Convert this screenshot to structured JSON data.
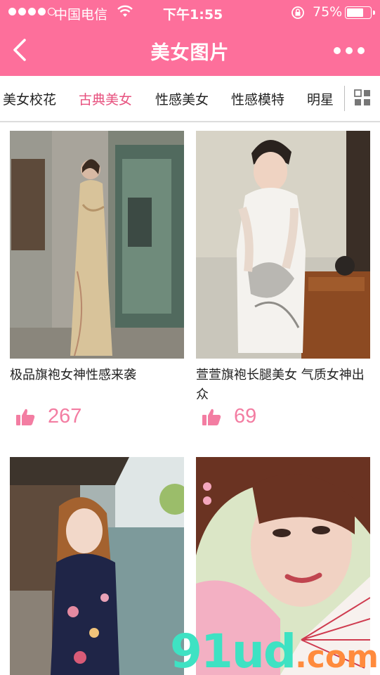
{
  "status_bar": {
    "carrier": "中国电信",
    "time": "下午1:55",
    "battery": "75%",
    "battery_level": 0.75
  },
  "navbar": {
    "title": "美女图片"
  },
  "tabs": [
    {
      "label": "美女校花",
      "active": false
    },
    {
      "label": "古典美女",
      "active": true
    },
    {
      "label": "性感美女",
      "active": false
    },
    {
      "label": "性感模特",
      "active": false
    },
    {
      "label": "明星",
      "active": false
    }
  ],
  "cards": [
    {
      "caption": "极品旗袍女神性感来袭",
      "likes": "267"
    },
    {
      "caption": "萱萱旗袍长腿美女 气质女神出众",
      "likes": "69"
    },
    {
      "caption": "",
      "likes": ""
    },
    {
      "caption": "",
      "likes": ""
    }
  ],
  "watermark": {
    "main": "91ud",
    "suffix": ".com"
  },
  "colors": {
    "header": "#fd6f9b",
    "active_tab": "#e7507e",
    "like": "#f37da2"
  }
}
